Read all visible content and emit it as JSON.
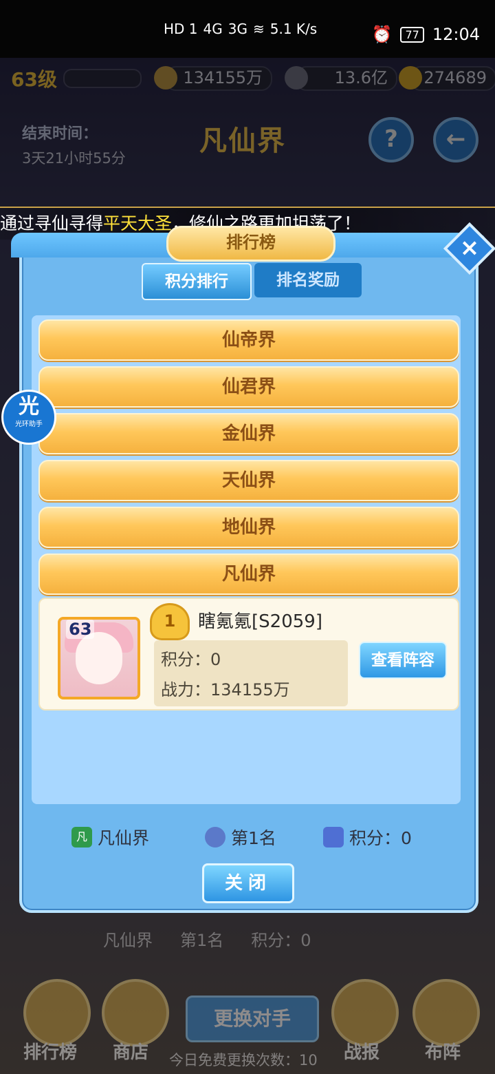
{
  "status_bar": {
    "network_left": "HD 1",
    "signal_4g": "4G",
    "signal_3g": "3G",
    "speed": "5.1 K/s",
    "battery": "77",
    "time": "12:04"
  },
  "top_bar": {
    "level": "63级",
    "power_value": "134155万",
    "silver": "13.6亿",
    "gold": "274689"
  },
  "event": {
    "end_label": "结束时间：",
    "end_time": "3天21小时55分",
    "realm_title": "凡仙界",
    "help_icon": "?",
    "back_icon": "←"
  },
  "marquee": {
    "prefix": "通过寻仙寻得",
    "highlight": "平天大圣",
    "suffix": "，修仙之路更加坦荡了！"
  },
  "modal": {
    "title": "排行榜",
    "close_icon": "×",
    "tabs": [
      "积分排行",
      "排名奖励"
    ],
    "realms": [
      "仙帝界",
      "仙君界",
      "金仙界",
      "天仙界",
      "地仙界",
      "凡仙界"
    ],
    "player": {
      "level": "63",
      "rank_badge": "1",
      "name": "瞎氪氪[S2059]",
      "score_line": "积分：0",
      "power_line": "战力：134155万",
      "view_button": "查看阵容"
    },
    "footer": {
      "realm_icon": "凡",
      "realm": "凡仙界",
      "rank": "第1名",
      "score": "积分：0",
      "close_button": "关闭"
    }
  },
  "background": {
    "stats": {
      "realm": "凡仙界",
      "rank": "第1名",
      "score": "积分：0"
    },
    "nav": {
      "leaderboard": "排行榜",
      "shop": "商店",
      "change_opponent": "更换对手",
      "free_changes": "今日免费更换次数：10",
      "battle_report": "战报",
      "formation": "布阵"
    }
  },
  "helper": {
    "icon_text": "光",
    "label": "光环助手"
  },
  "colors": {
    "realm_row": "#f8bf4e",
    "modal_blue": "#6fb8ef",
    "accent_blue": "#2f8ad8",
    "title_gold": "#ffcf55"
  }
}
